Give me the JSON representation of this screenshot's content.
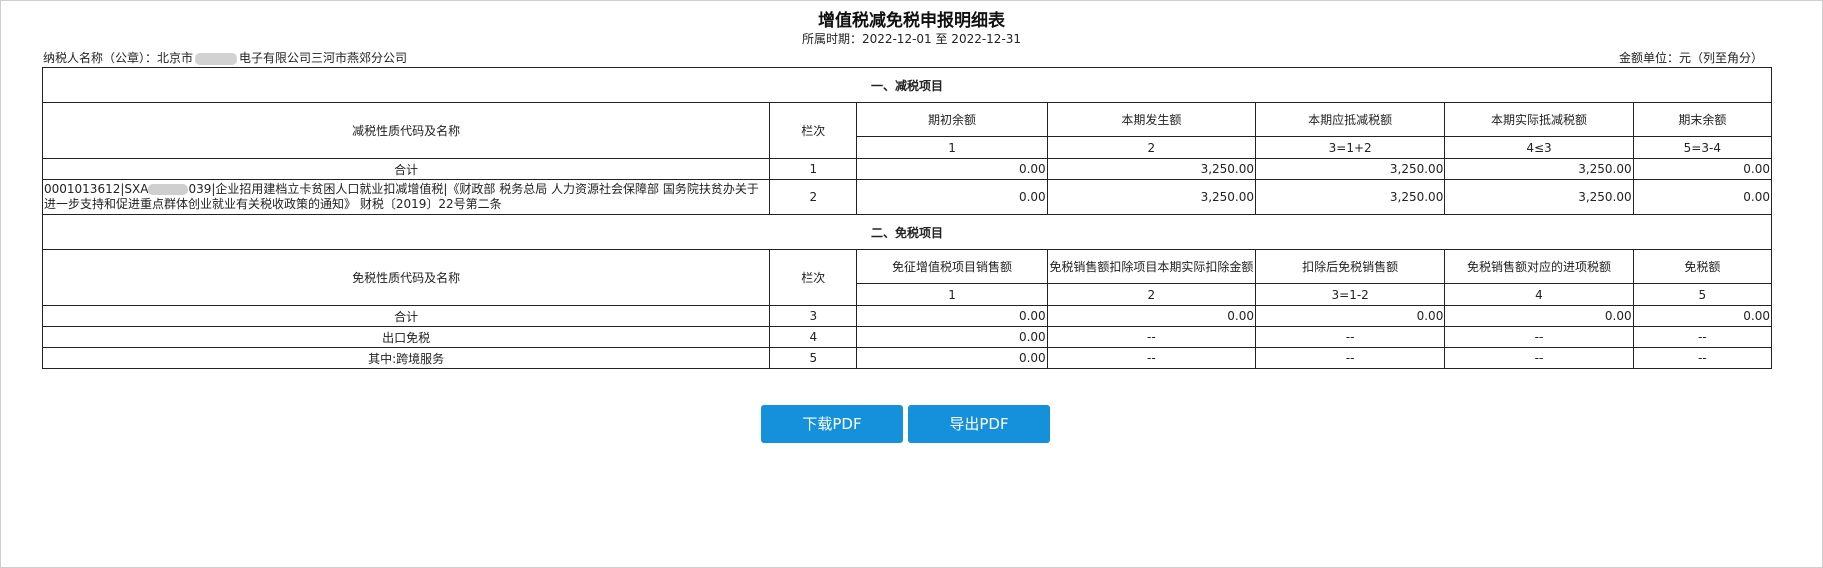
{
  "report": {
    "title": "增值税减免税申报明细表",
    "period": "所属时期：2022-12-01 至 2022-12-31",
    "taxpayer_prefix": "纳税人名称（公章）：北京市",
    "taxpayer_suffix": "电子有限公司三河市燕郊分公司",
    "unit": "金额单位：元（列至角分）"
  },
  "reduction": {
    "section_title": "一、减税项目",
    "col_name": "减税性质代码及名称",
    "col_line": "栏次",
    "headers": [
      "期初余额",
      "本期发生额",
      "本期应抵减税额",
      "本期实际抵减税额",
      "期末余额"
    ],
    "formulas": [
      "1",
      "2",
      "3=1+2",
      "4≤3",
      "5=3-4"
    ],
    "rows": [
      {
        "name": "合计",
        "line": "1",
        "values": [
          "0.00",
          "3,250.00",
          "3,250.00",
          "3,250.00",
          "0.00"
        ]
      }
    ],
    "detail_row": {
      "name_start": "0001013612|SXA",
      "name_rest": "039|企业招用建档立卡贫困人口就业扣减增值税|《财政部 税务总局 人力资源社会保障部 国务院扶贫办关于进一步支持和促进重点群体创业就业有关税收政策的通知》 财税〔2019〕22号第二条",
      "line": "2",
      "values": [
        "0.00",
        "3,250.00",
        "3,250.00",
        "3,250.00",
        "0.00"
      ]
    }
  },
  "exemption": {
    "section_title": "二、免税项目",
    "col_name": "免税性质代码及名称",
    "col_line": "栏次",
    "headers": [
      "免征增值税项目销售额",
      "免税销售额扣除项目本期实际扣除金额",
      "扣除后免税销售额",
      "免税销售额对应的进项税额",
      "免税额"
    ],
    "formulas": [
      "1",
      "2",
      "3=1-2",
      "4",
      "5"
    ],
    "rows": [
      {
        "name": "合计",
        "line": "3",
        "values": [
          "0.00",
          "0.00",
          "0.00",
          "0.00",
          "0.00"
        ]
      },
      {
        "name": "出口免税",
        "line": "4",
        "values": [
          "0.00",
          "--",
          "--",
          "--",
          "--"
        ]
      },
      {
        "name": "其中:跨境服务",
        "line": "5",
        "values": [
          "0.00",
          "--",
          "--",
          "--",
          "--"
        ]
      }
    ]
  },
  "buttons": {
    "download": "下载PDF",
    "export": "导出PDF"
  }
}
